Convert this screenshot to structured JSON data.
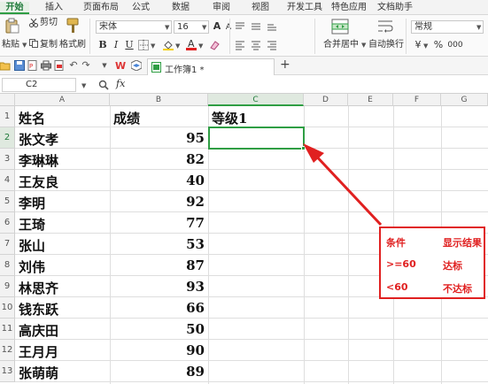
{
  "ribbon_tabs": [
    "开始",
    "插入",
    "页面布局",
    "公式",
    "数据",
    "审阅",
    "视图",
    "开发工具",
    "特色应用",
    "文档助手"
  ],
  "toolbar": {
    "cut": "剪切",
    "paste": "粘贴",
    "copy": "复制",
    "format_painter": "格式刷",
    "font_name": "宋体",
    "font_size": "16",
    "bold": "B",
    "italic": "I",
    "underline": "U",
    "merge_center": "合并居中",
    "wrap_text": "自动换行",
    "number_format": "常规",
    "currency": "¥",
    "percent": "%",
    "thousands": "000"
  },
  "document_tab": {
    "title": "工作簿1 *",
    "add": "+"
  },
  "formula_bar": {
    "name_box": "C2",
    "fx": "fx",
    "content": ""
  },
  "columns": [
    "A",
    "B",
    "C",
    "D",
    "E",
    "F",
    "G"
  ],
  "rows": [
    "1",
    "2",
    "3",
    "4",
    "5",
    "6",
    "7",
    "8",
    "9",
    "10",
    "11",
    "12",
    "13"
  ],
  "selected_cell": "C2",
  "sheet": {
    "headers": [
      "姓名",
      "成绩",
      "等级1"
    ],
    "records": [
      {
        "name": "张文孝",
        "score": "95"
      },
      {
        "name": "李琳琳",
        "score": "82"
      },
      {
        "name": "王友良",
        "score": "40"
      },
      {
        "name": "李明",
        "score": "92"
      },
      {
        "name": "王琦",
        "score": "77"
      },
      {
        "name": "张山",
        "score": "53"
      },
      {
        "name": "刘伟",
        "score": "87"
      },
      {
        "name": "林思齐",
        "score": "93"
      },
      {
        "name": "钱东跃",
        "score": "66"
      },
      {
        "name": "高庆田",
        "score": "50"
      },
      {
        "name": "王月月",
        "score": "90"
      },
      {
        "name": "张萌萌",
        "score": "89"
      }
    ]
  },
  "annotation_box": {
    "rows": [
      [
        "条件",
        "显示结果"
      ],
      [
        ">=60",
        "达标"
      ],
      [
        "<60",
        "不达标"
      ]
    ],
    "color": "#e02020"
  },
  "colors": {
    "accent": "#2f9e44",
    "annotation": "#e02020"
  }
}
